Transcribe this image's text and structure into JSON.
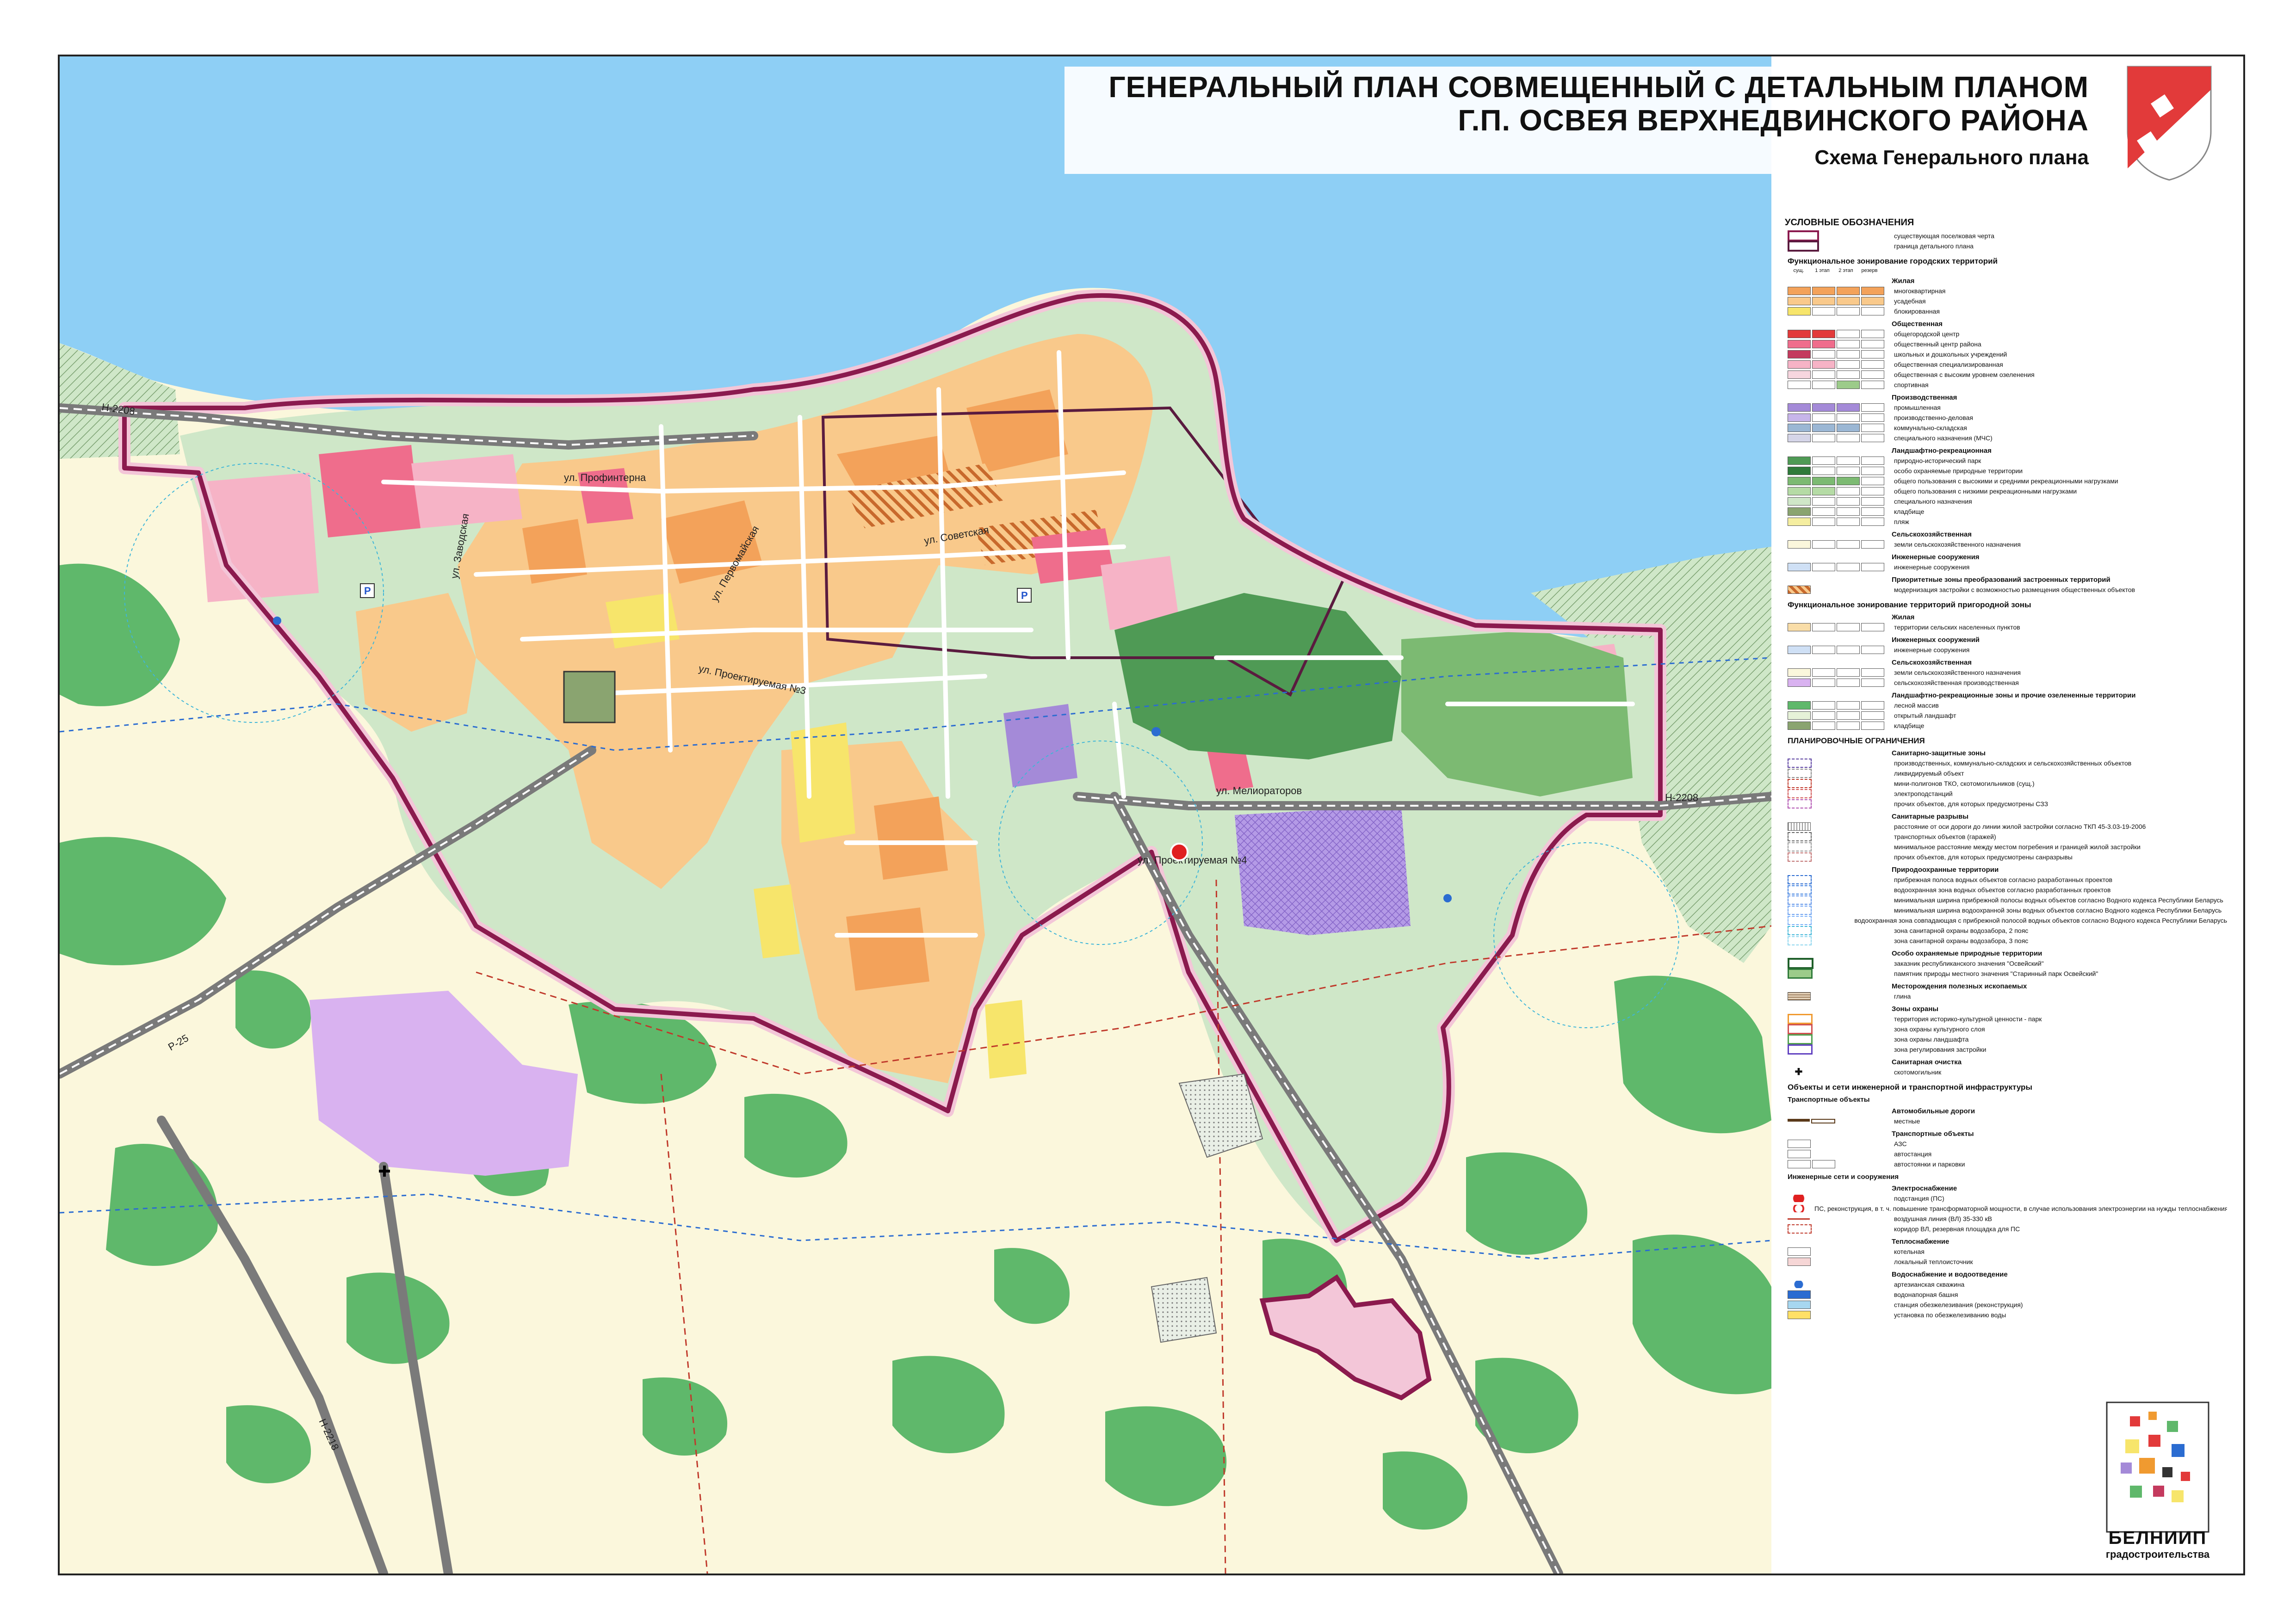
{
  "title": {
    "line1": "ГЕНЕРАЛЬНЫЙ ПЛАН СОВМЕЩЕННЫЙ С ДЕТАЛЬНЫМ ПЛАНОМ",
    "line2": "Г.П. ОСВЕЯ ВЕРХНЕДВИНСКОГО РАЙОНА",
    "subtitle": "Схема Генерального плана"
  },
  "map": {
    "streets": {
      "profinterna": "ул. Профинтерна",
      "sovetskaya": "ул. Советская",
      "proektiruemaya3": "ул. Проектируемая №3",
      "proektiruemaya4": "ул. Проектируемая №4",
      "melioratorov": "ул. Мелиораторов",
      "zavodskaya": "ул. Заводская",
      "pervomayskaya": "ул. Первомайская"
    },
    "roads": {
      "road_nw": "Н-2208",
      "road_e": "Н-2208",
      "road_w": "Р-25",
      "road_sw": "Н-2218"
    },
    "symbols": {
      "parking": "P"
    },
    "colors": {
      "lake": "#8ecff5",
      "residential_manor": "#f9c98b",
      "residential_apartment": "#f3a25a",
      "forest": "#5fb86b",
      "park": "#9ccb8a",
      "boundary": "#8b1a4e",
      "public_center": "#ef6d8c",
      "industrial": "#a48ad8",
      "agricultural": "#fbf7dc"
    }
  },
  "legend": {
    "title": "УСЛОВНЫЕ ОБОЗНАЧЕНИЯ",
    "boundary_items": [
      "существующая поселковая черта",
      "граница детального плана"
    ],
    "stage_headers": [
      "сущ.",
      "1 этап",
      "2 этап",
      "резерв"
    ],
    "urban_zoning": {
      "title": "Функциональное зонирование городских территорий",
      "groups": [
        {
          "name": "Жилая",
          "items": [
            "многоквартирная",
            "усадебная",
            "блокированная"
          ]
        },
        {
          "name": "Общественная",
          "items": [
            "общегородской центр",
            "общественный центр района",
            "школьных и дошкольных учреждений",
            "общественная специализированная",
            "общественная с высоким уровнем озеленения",
            "спортивная"
          ]
        },
        {
          "name": "Производственная",
          "items": [
            "промышленная",
            "производственно-деловая",
            "коммунально-складская",
            "специального назначения (МЧС)"
          ]
        },
        {
          "name": "Ландшафтно-рекреационная",
          "items": [
            "природно-исторический парк",
            "особо охраняемые природные территории",
            "общего пользования с высокими и средними рекреационными нагрузками",
            "общего пользования с низкими рекреационными нагрузками",
            "специального назначения",
            "кладбище",
            "пляж"
          ]
        },
        {
          "name": "Сельскохозяйственная",
          "items": [
            "земли сельскохозяйственного назначения"
          ]
        },
        {
          "name": "Инженерные сооружения",
          "items": [
            "инженерные сооружения"
          ]
        },
        {
          "name": "Приоритетные зоны преобразований застроенных территорий",
          "items": [
            "модернизация застройки с возможностью размещения общественных объектов"
          ]
        }
      ]
    },
    "suburban_zoning": {
      "title": "Функциональное зонирование территорий пригородной зоны",
      "groups": [
        {
          "name": "Жилая",
          "items": [
            "территории сельских населенных пунктов"
          ]
        },
        {
          "name": "Инженерных сооружений",
          "items": [
            "инженерные сооружения"
          ]
        },
        {
          "name": "Сельскохозяйственная",
          "items": [
            "земли сельскохозяйственного назначения",
            "сельскохозяйственная производственная"
          ]
        },
        {
          "name": "Ландшафтно-рекреационные зоны и прочие озелененные территории",
          "items": [
            "лесной массив",
            "открытый ландшафт",
            "кладбище"
          ]
        }
      ]
    },
    "planning_restrictions": {
      "title": "ПЛАНИРОВОЧНЫЕ ОГРАНИЧЕНИЯ",
      "groups": [
        {
          "name": "Санитарно-защитные зоны",
          "items": [
            "производственных, коммунально-складских и сельскохозяйственных объектов",
            "ликвидируемый объект",
            "мини-полигонов ТКО, скотомогильников (сущ.)",
            "электроподстанций",
            "прочих объектов, для которых предусмотрены СЗЗ"
          ]
        },
        {
          "name": "Санитарные разрывы",
          "items": [
            "расстояние от оси дороги до линии жилой застройки согласно ТКП 45-3.03-19-2006",
            "транспортных объектов (гаражей)",
            "минимальное расстояние между местом погребения и границей жилой застройки",
            "прочих объектов, для которых предусмотрены санразрывы"
          ]
        },
        {
          "name": "Природоохранные территории",
          "items": [
            "прибрежная полоса водных объектов согласно разработанных проектов",
            "водоохранная зона водных объектов согласно разработанных проектов",
            "минимальная ширина прибрежной полосы водных объектов согласно Водного кодекса Республики Беларусь",
            "минимальная ширина водоохранной зоны водных объектов согласно Водного кодекса Республики Беларусь",
            "водоохранная зона совпадающая с прибрежной полосой водных объектов согласно Водного кодекса Республики Беларусь",
            "зона санитарной охраны водозабора, 2 пояс",
            "зона санитарной охраны водозабора, 3 пояс"
          ]
        },
        {
          "name": "Особо охраняемые природные территории",
          "items": [
            "заказник республиканского значения \"Освейский\"",
            "памятник природы местного значения \"Старинный парк Освейский\""
          ]
        },
        {
          "name": "Месторождения полезных ископаемых",
          "items": [
            "глина"
          ]
        },
        {
          "name": "Зоны охраны",
          "items": [
            "территория историко-культурной ценности - парк",
            "зона охраны культурного слоя",
            "зона охраны ландшафта",
            "зона регулирования застройки"
          ]
        },
        {
          "name": "Санитарная очистка",
          "items": [
            "скотомогильник"
          ]
        }
      ]
    },
    "infrastructure": {
      "title": "Объекты и сети инженерной и транспортной инфраструктуры",
      "transport_title": "Транспортные объекты",
      "groups": [
        {
          "name": "Автомобильные дороги",
          "items": [
            "местные"
          ]
        },
        {
          "name": "Транспортные объекты",
          "items": [
            "АЗС",
            "автостанция",
            "автостоянки и парковки"
          ]
        }
      ],
      "engineering_title": "Инженерные сети и сооружения",
      "eng_groups": [
        {
          "name": "Электроснабжение",
          "items": [
            "подстанция (ПС)",
            "ПС, реконструкция, в т. ч. повышение трансформаторной мощности, в случае использования электроэнергии на нужды теплоснабжения",
            "воздушная линия (ВЛ) 35-330 кВ",
            "коридор ВЛ, резервная площадка для ПС"
          ]
        },
        {
          "name": "Теплоснабжение",
          "items": [
            "котельная",
            "локальный теплоисточник"
          ]
        },
        {
          "name": "Водоснабжение и водоотведение",
          "items": [
            "артезианская скважина",
            "водонапорная башня",
            "станция обезжелезивания (реконструкция)",
            "установка по обезжелезиванию воды"
          ]
        }
      ]
    }
  },
  "org": {
    "name": "БЕЛНИИП",
    "tagline": "градостроительства"
  }
}
